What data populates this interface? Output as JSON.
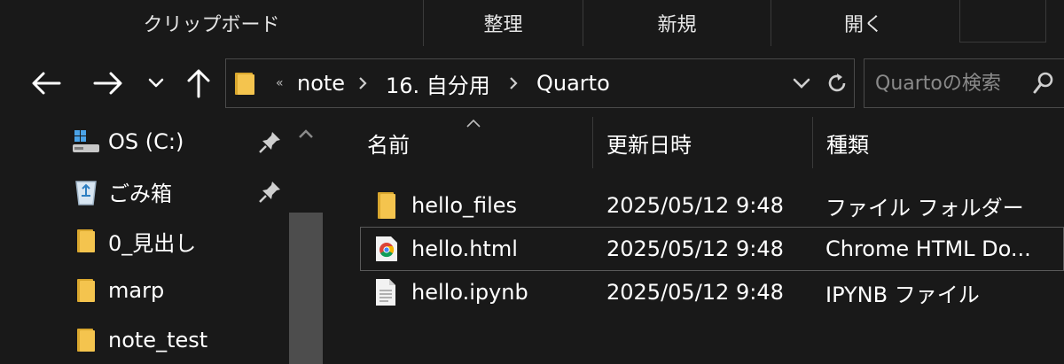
{
  "ribbon": {
    "groups": [
      {
        "label": "クリップボード"
      },
      {
        "label": "整理"
      },
      {
        "label": "新規"
      },
      {
        "label": "開く"
      }
    ]
  },
  "nav": {
    "back_icon": "arrow-left-icon",
    "forward_icon": "arrow-right-icon",
    "recent_icon": "chevron-down-icon",
    "up_icon": "arrow-up-icon"
  },
  "address": {
    "overflow": "«",
    "crumbs": [
      "note",
      "16. 自分用",
      "Quarto"
    ]
  },
  "search": {
    "placeholder": "Quartoの検索"
  },
  "navpane": {
    "items": [
      {
        "label": "OS (C:)",
        "icon": "drive-icon",
        "pinned": true
      },
      {
        "label": "ごみ箱",
        "icon": "recycle-bin-icon",
        "pinned": true
      },
      {
        "label": "0_見出し",
        "icon": "folder-icon",
        "pinned": false
      },
      {
        "label": "marp",
        "icon": "folder-icon",
        "pinned": false
      },
      {
        "label": "note_test",
        "icon": "folder-icon",
        "pinned": false
      }
    ]
  },
  "filelist": {
    "columns": {
      "name": "名前",
      "date": "更新日時",
      "type": "種類"
    },
    "rows": [
      {
        "name": "hello_files",
        "date": "2025/05/12 9:48",
        "type": "ファイル フォルダー",
        "icon": "folder-icon"
      },
      {
        "name": "hello.html",
        "date": "2025/05/12 9:48",
        "type": "Chrome HTML Do...",
        "icon": "chrome-icon"
      },
      {
        "name": "hello.ipynb",
        "date": "2025/05/12 9:48",
        "type": "IPYNB ファイル",
        "icon": "document-icon"
      }
    ]
  },
  "colors": {
    "background": "#191919",
    "border": "#4a4a4a",
    "folder": "#f4c44e",
    "folder_dark": "#d9a72e"
  }
}
